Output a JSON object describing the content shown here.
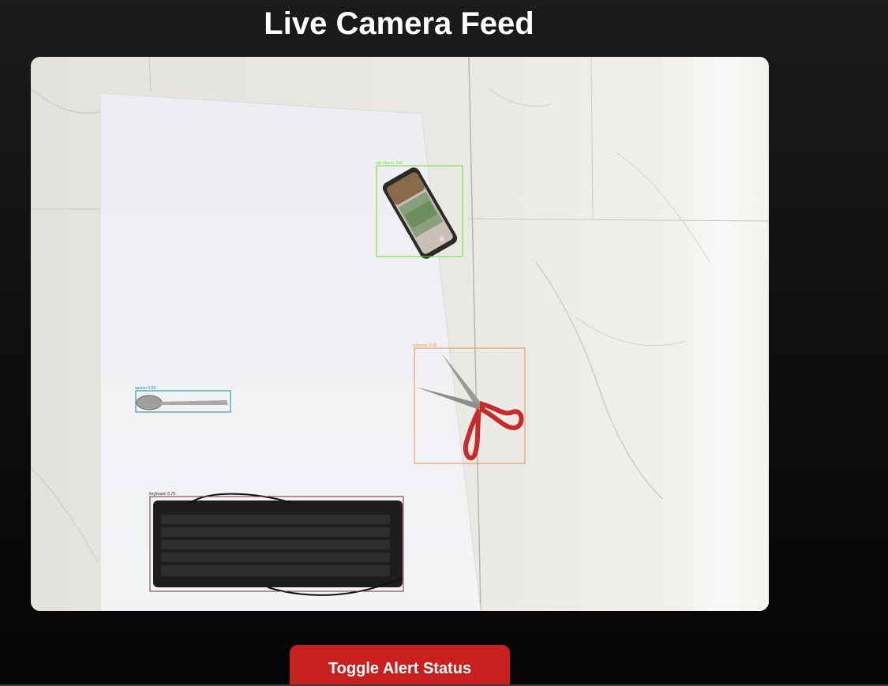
{
  "header": {
    "title": "Live Camera Feed"
  },
  "camera_feed": {
    "detections": [
      {
        "label": "cell phone: 0.87",
        "color": "#66e02b"
      },
      {
        "label": "scissors: 0.90",
        "color": "#f0914a"
      },
      {
        "label": "spoon: 0.53",
        "color": "#1d8a94"
      },
      {
        "label": "keyboard: 0.79",
        "color": "#7a2e3a"
      }
    ]
  },
  "controls": {
    "toggle_alert_label": "Toggle Alert Status",
    "toggle_color": "#c8201f"
  }
}
